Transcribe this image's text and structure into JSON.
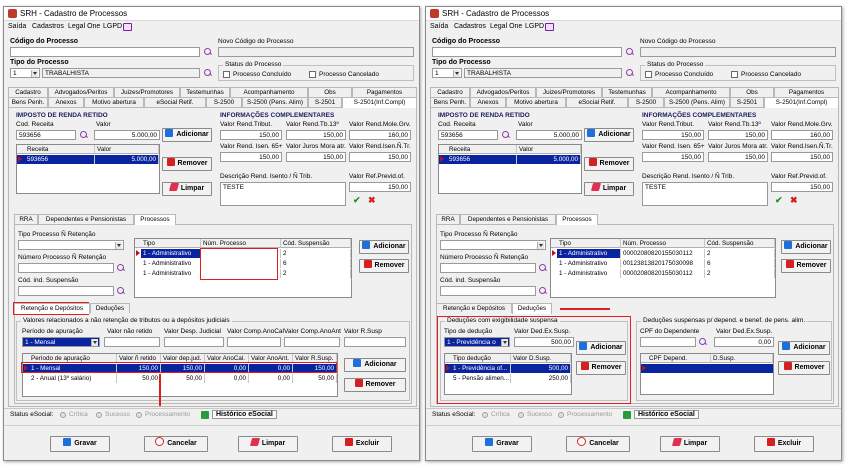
{
  "left": {
    "title": "SRH - Cadastro de Processos",
    "menu": [
      "Saída",
      "Cadastros",
      "Legal One",
      "LGPD"
    ],
    "codigo_label": "Código do Processo",
    "novo_codigo_label": "Novo Código do Processo",
    "tipo_label": "Tipo do Processo",
    "tipo_code": "1",
    "tipo_name": "TRABALHISTA",
    "status_title": "Status do Processo",
    "status_concluido": "Processo Concluído",
    "status_cancelado": "Processo Cancelado",
    "tabs_row1": [
      "Cadastro",
      "Advogados/Peritos",
      "Juizes/Promotores",
      "Testemunhas",
      "Acompanhamento",
      "Obs",
      "Pagamentos"
    ],
    "tabs_row2": [
      "Bens Penh.",
      "Anexos",
      "Motivo abertura",
      "eSocial Retif.",
      "S-2500",
      "S-2500 (Pens. Alim)",
      "S-2501",
      "S-2501(Inf.Compl)"
    ],
    "irr_title": "IMPOSTO DE RENDA RETIDO",
    "cod_receita_label": "Cod. Receita",
    "valor_label": "Valor",
    "cod_receita_value": "593656",
    "valor_value": "5.000,00",
    "btn_adicionar": "Adicionar",
    "btn_remover": "Remover",
    "btn_limpar": "Limpar",
    "grid_receita": {
      "h1": "Receita",
      "h2": "Valor",
      "r1c1": "593656",
      "r1c2": "5.000,00"
    },
    "info_title": "INFORMAÇÕES COMPLEMENTARES",
    "lbl_vr_trib": "Valor Rend.Tribut.",
    "lbl_vr_tb13": "Valor Rend.Tb.13º",
    "lbl_vr_mole": "Valor Rend.Mole.Grv.",
    "v_vr_trib": "150,00",
    "v_vr_tb13": "150,00",
    "v_vr_mole": "160,00",
    "lbl_isen65": "Valor Rend. Isen. 65+",
    "lbl_juros": "Valor Juros Mora atr.",
    "lbl_isen_tr": "Valor Rend.Isen.Ñ.Tr.",
    "v_isen65": "150,00",
    "v_juros": "150,00",
    "v_isen_tr": "150,00",
    "lbl_descricao": "Descrição Rend. Isento / Ñ Trib.",
    "lbl_prev": "Valor Ref.Previd.of.",
    "v_descricao": "TESTE",
    "v_prev": "150,00",
    "subtabs": [
      "RRA",
      "Dependentes e Pensionistas",
      "Processos"
    ],
    "lbl_tipo_proc_nret": "Tipo Processo Ñ Retenção",
    "lbl_num_proc_nret": "Número Processo Ñ Retenção",
    "lbl_cod_susp": "Cód. ind. Suspensão",
    "grid_proc": {
      "h1": "Tipo",
      "h2": "Núm. Processo",
      "h3": "Cód. Suspensão",
      "rows": [
        [
          "1 - Administrativo",
          "",
          "2"
        ],
        [
          "1 - Administrativo",
          "",
          "6"
        ],
        [
          "1 - Administrativo",
          "",
          "2"
        ]
      ]
    },
    "subtabs2": [
      "Retenção e Depósitos",
      "Deduções"
    ],
    "ret_title": "Valores relacionados a não retenção de tributos ou a depósitos judiciais",
    "lbl_periodo": "Período de apuração",
    "lbl_vnr": "Valor não retido",
    "lbl_vdj": "Valor Desp. Judicial",
    "lbl_vca": "Valor Comp.AnoCal",
    "lbl_vcaa": "Valor Comp.AnoAnt",
    "lbl_vrs": "Valor R.Susp",
    "v_periodo": "1 - Mensal",
    "grid_ret": {
      "headers": [
        "Período de apuração",
        "Valor ñ retido",
        "Valor dep.jud.",
        "Valor AnoCal.",
        "Valor AnoAnt.",
        "Valor R.Susp."
      ],
      "rows": [
        [
          "1 - Mensal",
          "150,00",
          "150,00",
          "0,00",
          "0,00",
          "150,00"
        ],
        [
          "2 - Anual (13º salário)",
          "50,00",
          "50,00",
          "0,00",
          "0,00",
          "50,00"
        ]
      ]
    },
    "status_label": "Status eSocial:",
    "status_critica": "Crítica",
    "status_sucesso": "Sucesso",
    "status_processamento": "Processamento",
    "historico": "Histórico eSocial",
    "btn_gravar": "Gravar",
    "btn_cancelar": "Cancelar",
    "btn_limpar_footer": "Limpar",
    "btn_excluir": "Excluir"
  },
  "right": {
    "title": "SRH - Cadastro de Processos",
    "menu": [
      "Saída",
      "Cadastros",
      "Legal One",
      "LGPD"
    ],
    "codigo_label": "Código do Processo",
    "novo_codigo_label": "Novo Código do Processo",
    "tipo_label": "Tipo do Processo",
    "tipo_code": "1",
    "tipo_name": "TRABALHISTA",
    "status_title": "Status do Processo",
    "status_concluido": "Processo Concluído",
    "status_cancelado": "Processo Cancelado",
    "tabs_row1": [
      "Cadastro",
      "Advogados/Peritos",
      "Juizes/Promotores",
      "Testemunhas",
      "Acompanhamento",
      "Obs",
      "Pagamentos"
    ],
    "tabs_row2": [
      "Bens Penh.",
      "Anexos",
      "Motivo abertura",
      "eSocial Retif.",
      "S-2500",
      "S-2500 (Pens. Alim)",
      "S-2501",
      "S-2501(Inf.Compl)"
    ],
    "irr_title": "IMPOSTO DE RENDA RETIDO",
    "cod_receita_label": "Cod. Receita",
    "valor_label": "Valor",
    "cod_receita_value": "593656",
    "valor_value": "5.000,00",
    "btn_adicionar": "Adicionar",
    "btn_remover": "Remover",
    "btn_limpar": "Limpar",
    "grid_receita": {
      "h1": "Receita",
      "h2": "Valor",
      "r1c1": "593656",
      "r1c2": "5.000,00"
    },
    "info_title": "INFORMAÇÕES COMPLEMENTARES",
    "lbl_vr_trib": "Valor Rend.Tribut.",
    "lbl_vr_tb13": "Valor Rend.Tb.13º",
    "lbl_vr_mole": "Valor Rend.Mole.Grv.",
    "v_vr_trib": "150,00",
    "v_vr_tb13": "150,00",
    "v_vr_mole": "160,00",
    "lbl_isen65": "Valor Rend. Isen. 65+",
    "lbl_juros": "Valor Juros Mora atr.",
    "lbl_isen_tr": "Valor Rend.Isen.Ñ.Tr.",
    "v_isen65": "150,00",
    "v_juros": "150,00",
    "v_isen_tr": "150,00",
    "lbl_descricao": "Descrição Rend. Isento / Ñ Trib.",
    "lbl_prev": "Valor Ref.Previd.of.",
    "v_descricao": "TESTE",
    "v_prev": "150,00",
    "subtabs": [
      "RRA",
      "Dependentes e Pensionistas",
      "Processos"
    ],
    "lbl_tipo_proc_nret": "Tipo Processo Ñ Retenção",
    "lbl_num_proc_nret": "Número Processo Ñ Retenção",
    "lbl_cod_susp": "Cód. ind. Suspensão",
    "grid_proc": {
      "h1": "Tipo",
      "h2": "Núm. Processo",
      "h3": "Cód. Suspensão",
      "rows": [
        [
          "1 - Administrativo",
          "00002080820155030112",
          "2"
        ],
        [
          "1 - Administrativo",
          "00123813820175030098",
          "6"
        ],
        [
          "1 - Administrativo",
          "00002080820155030112",
          "2"
        ]
      ]
    },
    "subtabs2": [
      "Retenção e Depósitos",
      "Deduções"
    ],
    "ded_title": "Deduções com exigibilidade suspensa",
    "lbl_tipo_ded": "Tipo de dedução",
    "lbl_vded": "Valor Ded.Ex.Susp.",
    "v_tipo_ded": "1 - Previdência o",
    "v_vded": "500,00",
    "grid_ded": {
      "headers": [
        "Tipo dedução",
        "Valor D.Susp."
      ],
      "rows": [
        [
          "1 - Previdência of...",
          "500,00"
        ],
        [
          "5 - Pensão alimen...",
          "250,00"
        ]
      ]
    },
    "dep_title": "Deduções suspensas p/ depend. e benef. de pens. alim.",
    "lbl_cpf": "CPF do Dependente",
    "lbl_vded2": "Valor Ded.Ex.Susp.",
    "v_vded2": "0,00",
    "grid_dep": {
      "headers": [
        "CPF Depend.",
        "D.Susp."
      ]
    },
    "status_label": "Status eSocial:",
    "status_critica": "Crítica",
    "status_sucesso": "Sucesso",
    "status_processamento": "Processamento",
    "historico": "Histórico eSocial",
    "btn_gravar": "Gravar",
    "btn_cancelar": "Cancelar",
    "btn_limpar_footer": "Limpar",
    "btn_excluir": "Excluir"
  }
}
